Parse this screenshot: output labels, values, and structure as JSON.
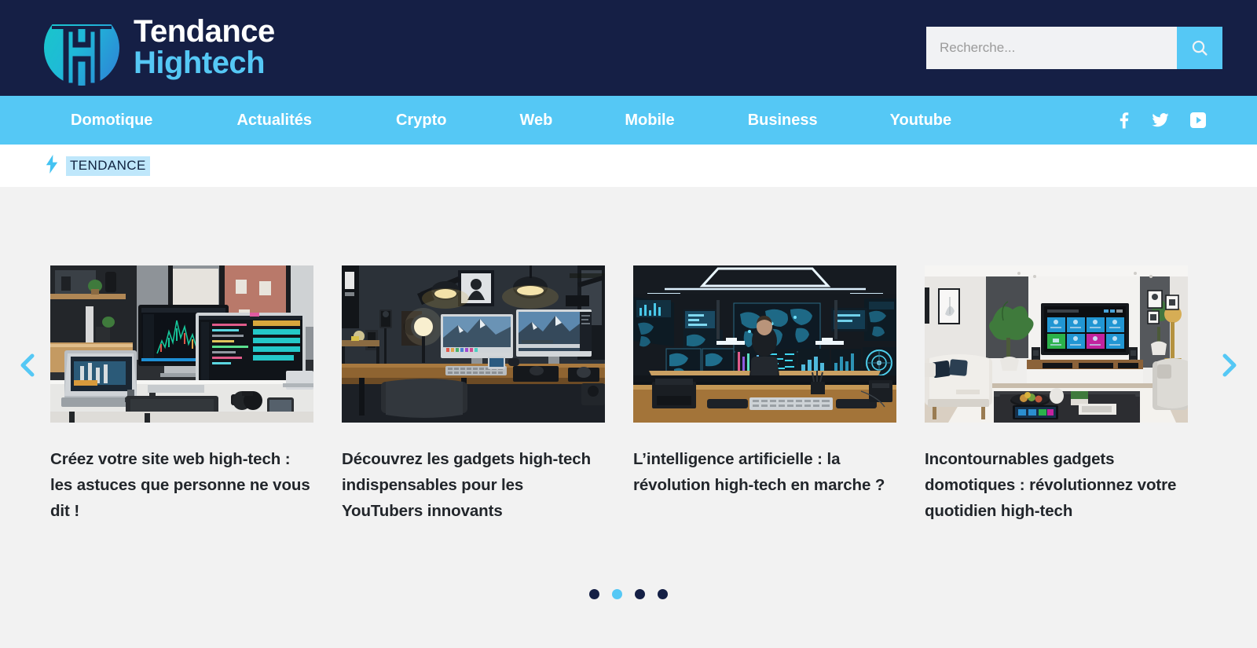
{
  "site": {
    "brand_line1": "Tendance",
    "brand_line2": "Hightech",
    "colors": {
      "header_bg": "#151f45",
      "nav_bg": "#55c8f5",
      "accent": "#55c8f5",
      "dot_inactive": "#141f45",
      "stage_bg": "#f2f2f2",
      "ticker_highlight": "#bfe7fb"
    }
  },
  "search": {
    "placeholder": "Recherche...",
    "value": "",
    "button_icon": "search-icon"
  },
  "nav": {
    "items": [
      {
        "label": "Domotique"
      },
      {
        "label": "Actualités"
      },
      {
        "label": "Crypto"
      },
      {
        "label": "Web"
      },
      {
        "label": "Mobile"
      },
      {
        "label": "Business"
      },
      {
        "label": "Youtube"
      }
    ],
    "social": [
      {
        "name": "facebook-icon"
      },
      {
        "name": "twitter-icon"
      },
      {
        "name": "youtube-icon"
      }
    ]
  },
  "ticker": {
    "icon": "lightning-bolt-icon",
    "label": "TENDANCE"
  },
  "carousel": {
    "prev_icon": "chevron-left-icon",
    "next_icon": "chevron-right-icon",
    "active_index": 1,
    "dots": 4,
    "cards": [
      {
        "title": "Créez votre site web high-tech : les astuces que personne ne vous dit !",
        "image_alt": "bright-office-desk-with-imac-laptop-and-trading-charts"
      },
      {
        "title": "Découvrez les gadgets high-tech indispensables pour les YouTubers innovants",
        "image_alt": "dark-creator-desk-with-dual-monitors-microphone-and-ring-light"
      },
      {
        "title": "L’intelligence artificielle : la révolution high-tech en marche ?",
        "image_alt": "control-room-with-world-map-screens-and-seated-operator"
      },
      {
        "title": "Incontournables gadgets domotiques : révolutionnez votre quotidien high-tech",
        "image_alt": "modern-living-room-with-smart-tv-app-tiles"
      }
    ]
  }
}
